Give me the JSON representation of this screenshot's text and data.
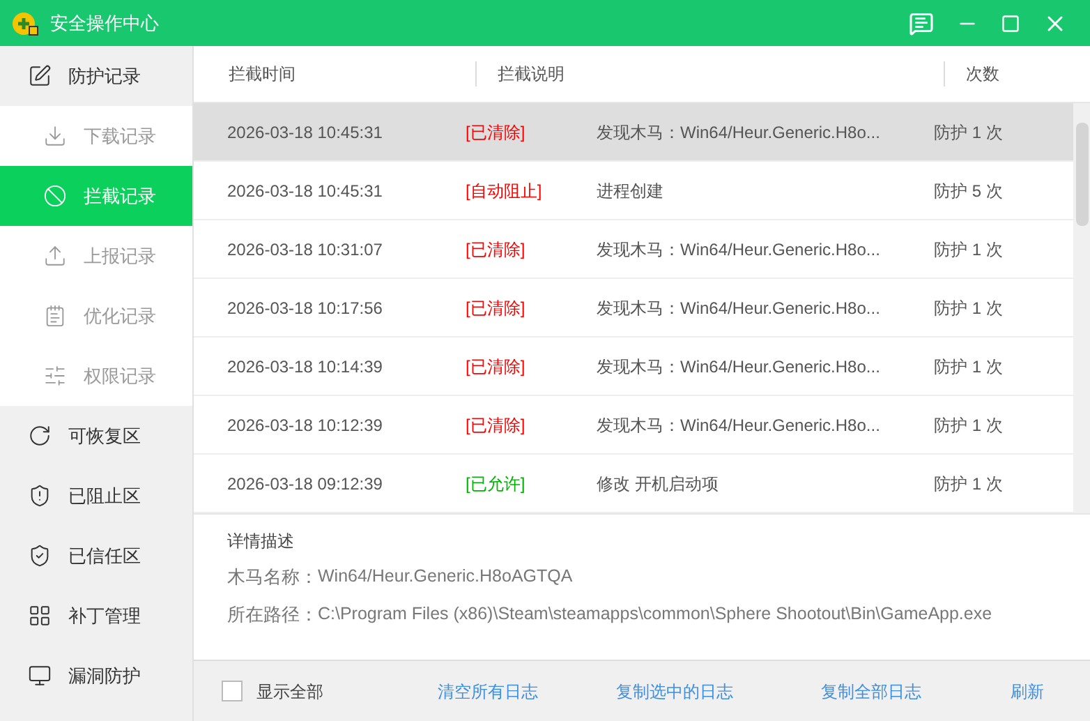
{
  "window": {
    "title": "安全操作中心"
  },
  "sidebar": {
    "items": [
      {
        "label": "防护记录",
        "selected": false,
        "children": [
          {
            "label": "下载记录",
            "selected": false
          },
          {
            "label": "拦截记录",
            "selected": true
          },
          {
            "label": "上报记录",
            "selected": false
          },
          {
            "label": "优化记录",
            "selected": false
          },
          {
            "label": "权限记录",
            "selected": false
          }
        ]
      },
      {
        "label": "可恢复区",
        "selected": false
      },
      {
        "label": "已阻止区",
        "selected": false
      },
      {
        "label": "已信任区",
        "selected": false
      },
      {
        "label": "补丁管理",
        "selected": false
      },
      {
        "label": "漏洞防护",
        "selected": false
      }
    ]
  },
  "table": {
    "columns": [
      "拦截时间",
      "拦截说明",
      "次数"
    ],
    "rows": [
      {
        "time": "2026-03-18 10:45:31",
        "status": "[已清除]",
        "color": "#ff0000",
        "description": "发现木马：Win64/Heur.Generic.H8o...",
        "count": "防护 1 次",
        "selected": true
      },
      {
        "time": "2026-03-18 10:45:31",
        "status": "[自动阻止]",
        "color": "#ff0000",
        "description": "进程创建",
        "count": "防护 5 次",
        "selected": false
      },
      {
        "time": "2026-03-18 10:31:07",
        "status": "[已清除]",
        "color": "#ff0000",
        "description": "发现木马：Win64/Heur.Generic.H8o...",
        "count": "防护 1 次",
        "selected": false
      },
      {
        "time": "2026-03-18 10:17:56",
        "status": "[已清除]",
        "color": "#ff0000",
        "description": "发现木马：Win64/Heur.Generic.H8o...",
        "count": "防护 1 次",
        "selected": false
      },
      {
        "time": "2026-03-18 10:14:39",
        "status": "[已清除]",
        "color": "#ff0000",
        "description": "发现木马：Win64/Heur.Generic.H8o...",
        "count": "防护 1 次",
        "selected": false
      },
      {
        "time": "2026-03-18 10:12:39",
        "status": "[已清除]",
        "color": "#ff0000",
        "description": "发现木马：Win64/Heur.Generic.H8o...",
        "count": "防护 1 次",
        "selected": false
      },
      {
        "time": "2026-03-18 09:12:39",
        "status": "[已允许]",
        "color": "#00b300",
        "description": "修改 开机启动项",
        "count": "防护 1 次",
        "selected": false
      }
    ]
  },
  "details": {
    "title": "详情描述",
    "lines": [
      {
        "label": "木马名称：",
        "value": "Win64/Heur.Generic.H8oAGTQA"
      },
      {
        "label": "所在路径：",
        "value": "C:\\Program Files (x86)\\Steam\\steamapps\\common\\Sphere Shootout\\Bin\\GameApp.exe"
      }
    ]
  },
  "footer": {
    "checkbox": {
      "label": "显示全部",
      "checked": false
    },
    "links": [
      "清空所有日志",
      "复制选中的日志",
      "复制全部日志",
      "刷新"
    ]
  }
}
